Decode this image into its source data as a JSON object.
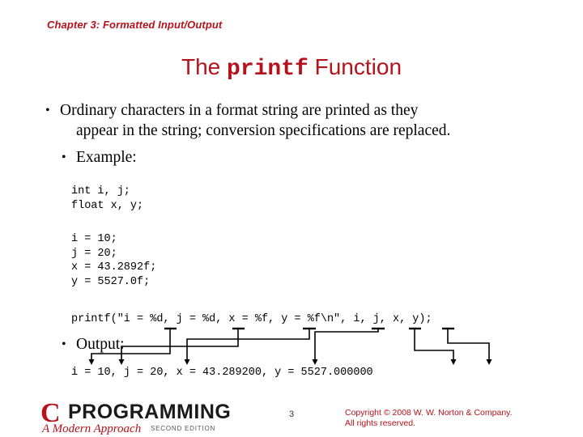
{
  "slide": {
    "chapter_header": "Chapter 3: Formatted Input/Output",
    "title_prefix": "The ",
    "title_mono": "printf",
    "title_suffix": " Function",
    "bullets": [
      {
        "line1": "Ordinary characters in a format string are printed as they",
        "line2": "appear in the string; conversion specifications are replaced."
      }
    ],
    "example_label": "Example:",
    "output_label": "Output:",
    "code_declarations": "int i, j;\nfloat x, y;",
    "code_assignments": "i = 10;\nj = 20;\nx = 43.2892f;\ny = 5527.0f;",
    "code_printf": "printf(\"i = %d, j = %d, x = %f, y = %f\\n\", i, j, x, y);",
    "code_output": "i = 10, j = 20, x = 43.289200, y = 5527.000000",
    "accent_color": "#b5121b"
  },
  "footer": {
    "logo_c": "C",
    "logo_programming": "PROGRAMMING",
    "logo_tagline": "A Modern Approach",
    "logo_edition": "SECOND EDITION",
    "page_number": "3",
    "copyright_line1": "Copyright © 2008 W. W. Norton & Company.",
    "copyright_line2": "All rights reserved."
  }
}
